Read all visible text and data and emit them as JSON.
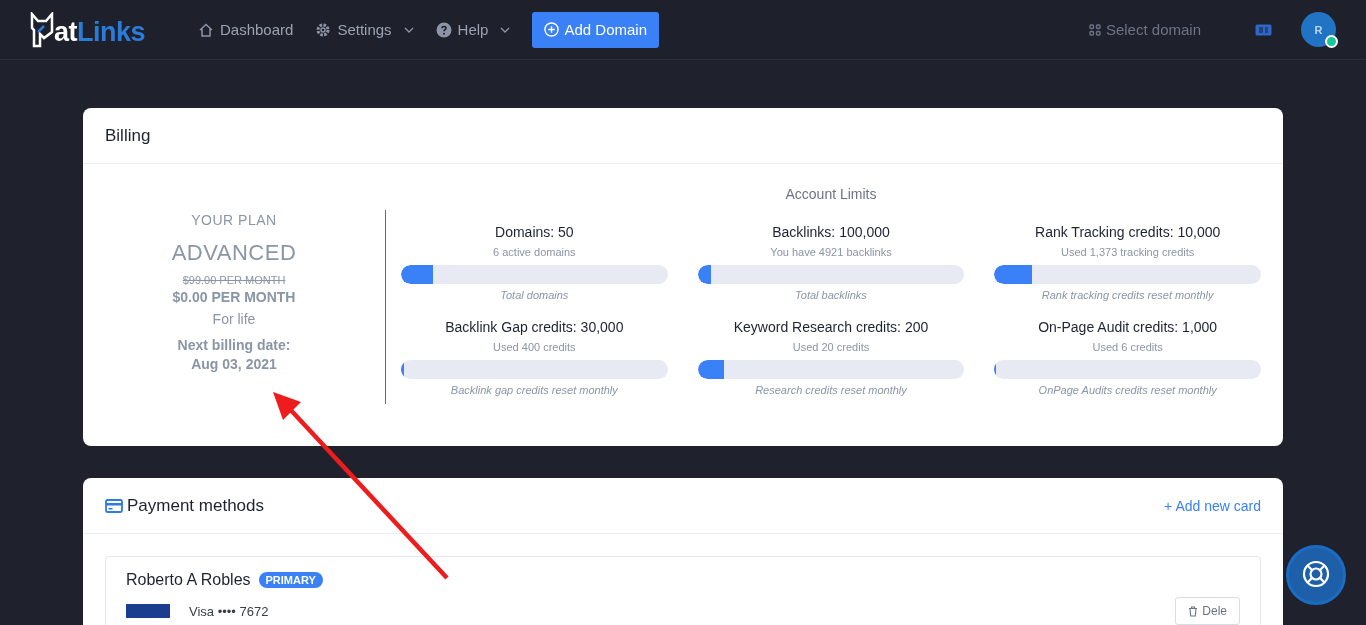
{
  "nav": {
    "logo": {
      "part_1": "at",
      "part_2": "Links"
    },
    "items": [
      {
        "label": "Dashboard",
        "kind": "home",
        "dropdown": false
      },
      {
        "label": "Settings",
        "kind": "settings",
        "dropdown": true
      },
      {
        "label": "Help",
        "kind": "help",
        "dropdown": true
      }
    ],
    "add_button": "Add Domain",
    "domain_select": "Select domain",
    "avatar": "R",
    "online": true
  },
  "billing": {
    "title": "Billing",
    "plan_label": "YOUR PLAN",
    "plan": "ADVANCED",
    "old_price": "$99.00 PER MONTH",
    "price": "$0.00 PER MONTH",
    "term": "For life",
    "next_label": "Next billing date:",
    "next_date": "Aug 03, 2021",
    "limits_title": "Account Limits",
    "limits": [
      {
        "title": "Domains: 50",
        "usage": "6 active domains",
        "level": 0.12,
        "note": "Total domains"
      },
      {
        "title": "Backlinks: 100,000",
        "usage": "You have 4921 backlinks",
        "level": 0.05,
        "note": "Total backlinks"
      },
      {
        "title": "Rank Tracking credits: 10,000",
        "usage": "Used 1,373 tracking credits",
        "level": 0.14,
        "note": "Rank tracking credits reset monthly"
      },
      {
        "title": "Backlink Gap credits: 30,000",
        "usage": "Used 400 credits",
        "level": 0.013,
        "note": "Backlink gap credits reset monthly"
      },
      {
        "title": "Keyword Research credits: 200",
        "usage": "Used 20 credits",
        "level": 0.1,
        "note": "Research credits reset monthly"
      },
      {
        "title": "On-Page Audit credits: 1,000",
        "usage": "Used 6 credits",
        "level": 0.006,
        "note": "OnPage Audits credits reset monthly"
      }
    ]
  },
  "payment": {
    "title": "Payment methods",
    "add_link": "+ Add new card",
    "cards": [
      {
        "holder": "Roberto A Robles",
        "primary": true,
        "badge": "PRIMARY",
        "number": "Visa •••• 7672",
        "button": "Dele"
      }
    ]
  }
}
